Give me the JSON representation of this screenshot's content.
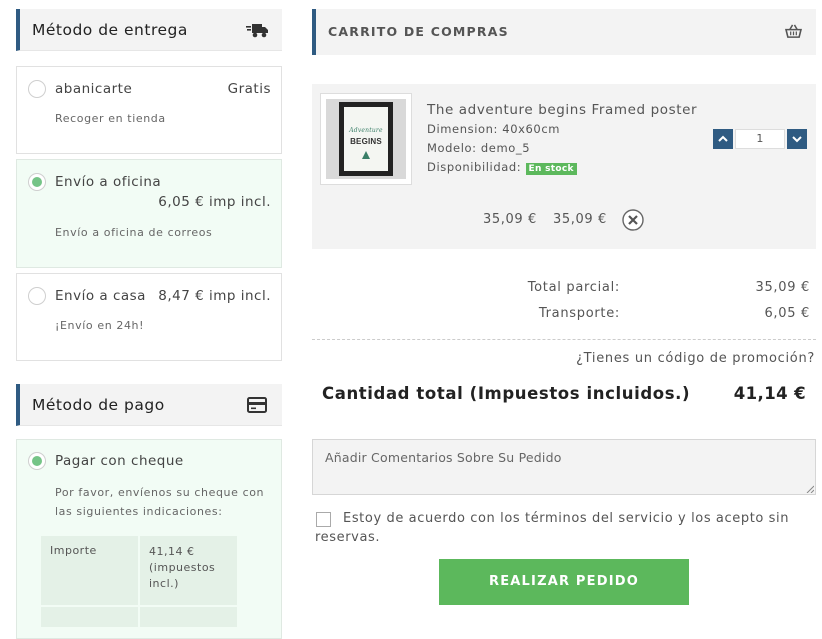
{
  "delivery": {
    "title": "Método de entrega",
    "icon": "truck-icon",
    "options": [
      {
        "name": "abanicarte",
        "price": "Gratis",
        "desc": "Recoger en tienda",
        "selected": false
      },
      {
        "name": "Envío a oficina",
        "price": "6,05 € imp incl.",
        "desc": "Envío a oficina de correos",
        "selected": true
      },
      {
        "name": "Envío a casa",
        "price": "8,47 € imp incl.",
        "desc": "¡Envío en 24h!",
        "selected": false
      }
    ]
  },
  "payment": {
    "title": "Método de pago",
    "icon": "credit-card-icon",
    "option": {
      "name": "Pagar con cheque",
      "desc": "Por favor, envíenos su cheque con las siguientes indicaciones:",
      "selected": true
    },
    "table": [
      {
        "label": "Importe",
        "value": "41,14 € (impuestos incl.)"
      }
    ]
  },
  "cart": {
    "title": "CARRITO DE COMPRAS",
    "icon": "basket-icon",
    "item": {
      "name": "The adventure begins Framed poster",
      "dimension_label": "Dimension:",
      "dimension_value": "40x60cm",
      "model_label": "Modelo:",
      "model_value": "demo_5",
      "availability_label": "Disponibilidad:",
      "availability_badge": "En stock",
      "poster_text_1": "Adventure",
      "poster_text_2": "BEGINS",
      "quantity": "1",
      "unit_price": "35,09 €",
      "total_price": "35,09 €"
    },
    "subtotal_label": "Total parcial:",
    "subtotal_value": "35,09 €",
    "shipping_label": "Transporte:",
    "shipping_value": "6,05 €",
    "promo_link": "¿Tienes un código de promoción?",
    "total_label": "Cantidad total (Impuestos incluidos.)",
    "total_value": "41,14 €",
    "comments_placeholder": "Añadir Comentarios Sobre Su Pedido",
    "terms_text": "Estoy de acuerdo con los términos del servicio y los acepto sin reservas.",
    "order_button": "REALIZAR PEDIDO"
  },
  "colors": {
    "accent": "#2f5b82",
    "green": "#5cb85c",
    "stock_badge": "#5cb85c"
  }
}
